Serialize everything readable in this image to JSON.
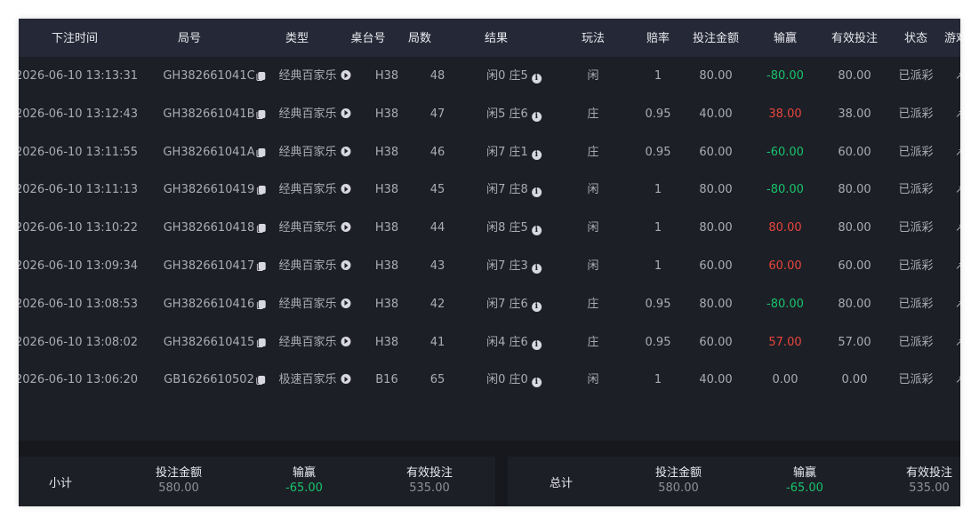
{
  "headers": [
    "下注时间",
    "局号",
    "类型",
    "桌台号",
    "局数",
    "结果",
    "玩法",
    "赔率",
    "投注金额",
    "输赢",
    "有效投注",
    "状态",
    "游戏"
  ],
  "rows": [
    {
      "time": "2026-06-10 13:13:31",
      "round": "GH382661041C",
      "type": "经典百家乐",
      "table": "H38",
      "num": "48",
      "result": "闲0 庄5",
      "bet": "闲",
      "odds": "1",
      "amount": "80.00",
      "winloss": "-80.00",
      "wl_class": "green",
      "valid": "80.00",
      "status": "已派彩"
    },
    {
      "time": "2026-06-10 13:12:43",
      "round": "GH382661041B",
      "type": "经典百家乐",
      "table": "H38",
      "num": "47",
      "result": "闲5 庄6",
      "bet": "庄",
      "odds": "0.95",
      "amount": "40.00",
      "winloss": "38.00",
      "wl_class": "red",
      "valid": "38.00",
      "status": "已派彩"
    },
    {
      "time": "2026-06-10 13:11:55",
      "round": "GH382661041A",
      "type": "经典百家乐",
      "table": "H38",
      "num": "46",
      "result": "闲7 庄1",
      "bet": "庄",
      "odds": "0.95",
      "amount": "60.00",
      "winloss": "-60.00",
      "wl_class": "green",
      "valid": "60.00",
      "status": "已派彩"
    },
    {
      "time": "2026-06-10 13:11:13",
      "round": "GH3826610419",
      "type": "经典百家乐",
      "table": "H38",
      "num": "45",
      "result": "闲7 庄8",
      "bet": "闲",
      "odds": "1",
      "amount": "80.00",
      "winloss": "-80.00",
      "wl_class": "green",
      "valid": "80.00",
      "status": "已派彩"
    },
    {
      "time": "2026-06-10 13:10:22",
      "round": "GH3826610418",
      "type": "经典百家乐",
      "table": "H38",
      "num": "44",
      "result": "闲8 庄5",
      "bet": "闲",
      "odds": "1",
      "amount": "80.00",
      "winloss": "80.00",
      "wl_class": "red",
      "valid": "80.00",
      "status": "已派彩"
    },
    {
      "time": "2026-06-10 13:09:34",
      "round": "GH3826610417",
      "type": "经典百家乐",
      "table": "H38",
      "num": "43",
      "result": "闲7 庄3",
      "bet": "闲",
      "odds": "1",
      "amount": "60.00",
      "winloss": "60.00",
      "wl_class": "red",
      "valid": "60.00",
      "status": "已派彩"
    },
    {
      "time": "2026-06-10 13:08:53",
      "round": "GH3826610416",
      "type": "经典百家乐",
      "table": "H38",
      "num": "42",
      "result": "闲7 庄6",
      "bet": "庄",
      "odds": "0.95",
      "amount": "80.00",
      "winloss": "-80.00",
      "wl_class": "green",
      "valid": "80.00",
      "status": "已派彩"
    },
    {
      "time": "2026-06-10 13:08:02",
      "round": "GH3826610415",
      "type": "经典百家乐",
      "table": "H38",
      "num": "41",
      "result": "闲4 庄6",
      "bet": "庄",
      "odds": "0.95",
      "amount": "60.00",
      "winloss": "57.00",
      "wl_class": "red",
      "valid": "57.00",
      "status": "已派彩"
    },
    {
      "time": "2026-06-10 13:06:20",
      "round": "GB1626610502",
      "type": "极速百家乐",
      "table": "B16",
      "num": "65",
      "result": "闲0 庄0",
      "bet": "闲",
      "odds": "1",
      "amount": "40.00",
      "winloss": "0.00",
      "wl_class": "",
      "valid": "0.00",
      "status": "已派彩"
    }
  ],
  "subtotal": {
    "label": "小计",
    "amount_label": "投注金额",
    "amount": "580.00",
    "winloss_label": "输赢",
    "winloss": "-65.00",
    "valid_label": "有效投注",
    "valid": "535.00"
  },
  "total": {
    "label": "总计",
    "amount_label": "投注金额",
    "amount": "580.00",
    "winloss_label": "输赢",
    "winloss": "-65.00",
    "valid_label": "有效投注",
    "valid": "535.00"
  },
  "icons": {
    "copy": "copy-icon",
    "video": "play-icon",
    "detail": "info-icon",
    "action": "arrow-icon"
  },
  "colors": {
    "loss": "#18c36b",
    "win": "#e8453c",
    "header_bg": "#252836",
    "body_bg": "#1d1f26"
  }
}
